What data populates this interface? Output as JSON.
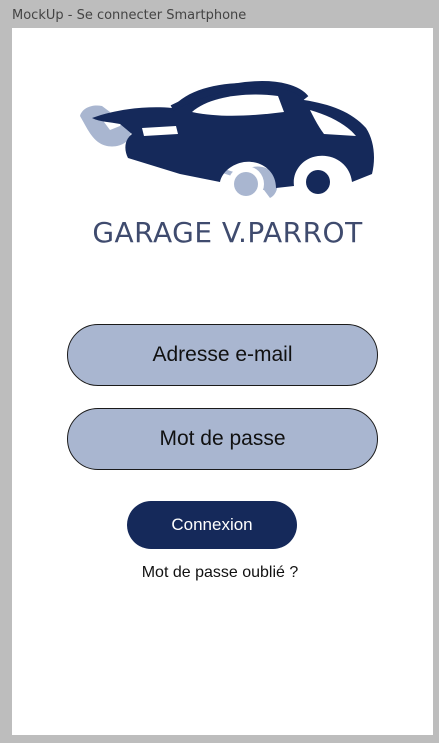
{
  "window": {
    "title": "MockUp - Se connecter Smartphone"
  },
  "logo": {
    "icon": "car-and-wrench-logo",
    "text": "GARAGE V.PARROT"
  },
  "form": {
    "email_label": "Adresse e-mail",
    "password_label": "Mot de passe",
    "submit_label": "Connexion",
    "forgot_label": "Mot de passe oublié ?"
  },
  "colors": {
    "brand_navy": "#15295a",
    "field_fill": "#a9b6d0",
    "wrench": "#a9b6d0",
    "logo_text": "#3f4b6e"
  }
}
